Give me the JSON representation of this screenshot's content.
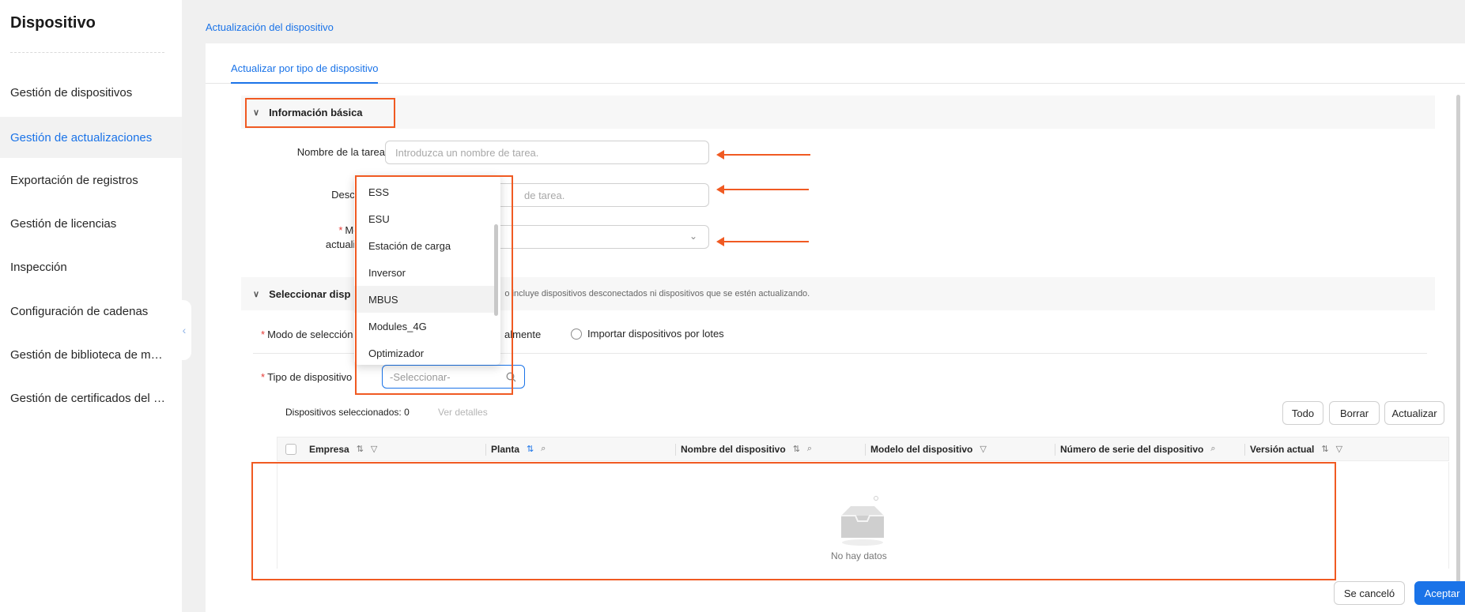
{
  "sidebar": {
    "title": "Dispositivo",
    "items": [
      {
        "label": "Gestión de dispositivos"
      },
      {
        "label": "Gestión de actualizaciones"
      },
      {
        "label": "Exportación de registros"
      },
      {
        "label": "Gestión de licencias"
      },
      {
        "label": "Inspección"
      },
      {
        "label": "Configuración de cadenas"
      },
      {
        "label": "Gestión de biblioteca de módulos"
      },
      {
        "label": "Gestión de certificados del dispositivo"
      }
    ],
    "active_index": 1
  },
  "page": {
    "breadcrumb": "Actualización del dispositivo",
    "tab": "Actualizar por tipo de dispositivo"
  },
  "basic_info": {
    "title": "Información básica",
    "task_name_label": "Nombre de la tarea",
    "task_name_placeholder": "Introduzca un nombre de tarea.",
    "description_label": "Descripción",
    "description_placeholder_visible": "de tarea.",
    "mode_label_line1": "Modo de",
    "mode_label_line2": "actualización"
  },
  "select_devices": {
    "title": "Seleccionar disp",
    "note": "o incluye dispositivos desconectados ni dispositivos que se estén actualizando.",
    "selection_mode_label": "Modo de selección",
    "radio_manual_visible": "almente",
    "radio_batch": "Importar dispositivos por lotes",
    "device_type_label": "Tipo de dispositivo",
    "device_type_placeholder": "-Seleccionar-",
    "selected_count_text": "Dispositivos seleccionados: 0",
    "view_details": "Ver detalles",
    "btn_all": "Todo",
    "btn_clear": "Borrar",
    "btn_refresh": "Actualizar"
  },
  "dropdown": {
    "options": [
      "ESS",
      "ESU",
      "Estación de carga",
      "Inversor",
      "MBUS",
      "Modules_4G",
      "Optimizador"
    ],
    "hovered": "MBUS"
  },
  "table": {
    "columns": [
      {
        "label": "Empresa",
        "icons": [
          "sort-icon",
          "filter-icon"
        ]
      },
      {
        "label": "Planta",
        "icons": [
          "sort-icon",
          "search-icon"
        ]
      },
      {
        "label": "Nombre del dispositivo",
        "icons": [
          "sort-icon",
          "search-icon"
        ]
      },
      {
        "label": "Modelo del dispositivo",
        "icons": [
          "filter-icon"
        ]
      },
      {
        "label": "Número de serie del dispositivo",
        "icons": [
          "search-icon"
        ]
      },
      {
        "label": "Versión actual",
        "icons": [
          "sort-icon",
          "filter-icon"
        ]
      }
    ],
    "empty_text_visible": "No hay datos"
  },
  "footer": {
    "cancel": "Se canceló",
    "accept": "Aceptar"
  },
  "colors": {
    "accent": "#1a73e8",
    "annotation": "#f05a22"
  }
}
